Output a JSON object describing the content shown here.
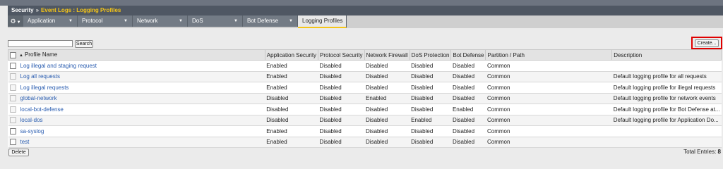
{
  "breadcrumb": {
    "section": "Security",
    "separator": "»",
    "path": "Event Logs : Logging Profiles"
  },
  "nav": {
    "gear_icon": "gear-icon",
    "tabs": [
      {
        "label": "Application",
        "dropdown": true,
        "active": false
      },
      {
        "label": "Protocol",
        "dropdown": true,
        "active": false
      },
      {
        "label": "Network",
        "dropdown": true,
        "active": false
      },
      {
        "label": "DoS",
        "dropdown": true,
        "active": false
      },
      {
        "label": "Bot Defense",
        "dropdown": true,
        "active": false
      },
      {
        "label": "Logging Profiles",
        "dropdown": false,
        "active": true
      }
    ]
  },
  "search": {
    "value": "",
    "button_label": "Search"
  },
  "create_button_label": "Create...",
  "table": {
    "columns": [
      "Profile Name",
      "Application Security",
      "Protocol Security",
      "Network Firewall",
      "DoS Protection",
      "Bot Defense",
      "Partition / Path",
      "Description"
    ],
    "sort_indicator": "▲",
    "rows": [
      {
        "name": "Log illegal and staging request",
        "checkbox_enabled": true,
        "app": "Enabled",
        "proto": "Disabled",
        "fw": "Disabled",
        "dos": "Disabled",
        "bot": "Disabled",
        "partition": "Common",
        "desc": ""
      },
      {
        "name": "Log all requests",
        "checkbox_enabled": false,
        "app": "Enabled",
        "proto": "Disabled",
        "fw": "Disabled",
        "dos": "Disabled",
        "bot": "Disabled",
        "partition": "Common",
        "desc": "Default logging profile for all requests"
      },
      {
        "name": "Log illegal requests",
        "checkbox_enabled": false,
        "app": "Enabled",
        "proto": "Disabled",
        "fw": "Disabled",
        "dos": "Disabled",
        "bot": "Disabled",
        "partition": "Common",
        "desc": "Default logging profile for illegal requests"
      },
      {
        "name": "global-network",
        "checkbox_enabled": false,
        "app": "Disabled",
        "proto": "Disabled",
        "fw": "Enabled",
        "dos": "Disabled",
        "bot": "Disabled",
        "partition": "Common",
        "desc": "Default logging profile for network events"
      },
      {
        "name": "local-bot-defense",
        "checkbox_enabled": false,
        "app": "Disabled",
        "proto": "Disabled",
        "fw": "Disabled",
        "dos": "Disabled",
        "bot": "Enabled",
        "partition": "Common",
        "desc": "Default logging profile for Bot Defense at..."
      },
      {
        "name": "local-dos",
        "checkbox_enabled": false,
        "app": "Disabled",
        "proto": "Disabled",
        "fw": "Disabled",
        "dos": "Enabled",
        "bot": "Disabled",
        "partition": "Common",
        "desc": "Default logging profile for Application Do..."
      },
      {
        "name": "sa-syslog",
        "checkbox_enabled": true,
        "app": "Enabled",
        "proto": "Disabled",
        "fw": "Disabled",
        "dos": "Disabled",
        "bot": "Disabled",
        "partition": "Common",
        "desc": ""
      },
      {
        "name": "test",
        "checkbox_enabled": true,
        "app": "Enabled",
        "proto": "Disabled",
        "fw": "Disabled",
        "dos": "Disabled",
        "bot": "Disabled",
        "partition": "Common",
        "desc": ""
      }
    ]
  },
  "delete_button_label": "Delete",
  "footer": {
    "total_label": "Total Entries:",
    "total_value": "8"
  },
  "colors": {
    "accent": "#f5c518",
    "link": "#2a5db0",
    "highlight_box": "#e00000"
  }
}
